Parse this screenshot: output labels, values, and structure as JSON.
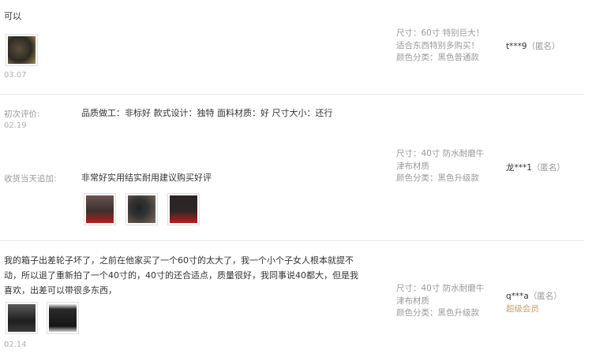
{
  "reviews": [
    {
      "content": "可以",
      "date": "03.07",
      "images": [
        "bag-photo-icon"
      ],
      "meta": {
        "size": "尺寸：60寸 特别巨大！",
        "size_extra": "适合东西特别多购买！",
        "color": "颜色分类：黑色普通款"
      },
      "user": {
        "name": "t***9",
        "anon": "（匿名）"
      }
    },
    {
      "initial_label": "初次评价:",
      "initial_date": "02.19",
      "initial_content": "品质做工：非标好 款式设计：独特 面料材质：好 尺寸大小：还行",
      "followup_label": "收货当天追加:",
      "followup_content": "非常好实用结实耐用建议购买好评",
      "images": [
        "suitcase-photo-icon",
        "suitcase-photo-icon",
        "suitcase-photo-icon"
      ],
      "meta": {
        "size": "尺寸：40寸 防水耐磨牛",
        "size_extra": "津布材质",
        "color": "颜色分类：黑色升级款"
      },
      "user": {
        "name": "龙***1",
        "anon": "（匿名）"
      }
    },
    {
      "content_lines": [
        "我的箱子出差轮子坏了，之前在他家买了一个60寸的太大了，我一个小个子女人根本就提不",
        "动，所以退了重新拍了一个40寸的，40寸的还合适点，质量很好，我同事说40都大，但是我",
        "喜欢，出差可以带很多东西，"
      ],
      "date": "02.14",
      "images": [
        "bag-photo-icon",
        "bag-photo-icon"
      ],
      "meta": {
        "size": "尺寸：40寸 防水耐磨牛",
        "size_extra": "津布材质",
        "color": "颜色分类：黑色升级款"
      },
      "user": {
        "name": "q***a",
        "anon": "（匿名）",
        "badge": "超级会员"
      }
    }
  ]
}
